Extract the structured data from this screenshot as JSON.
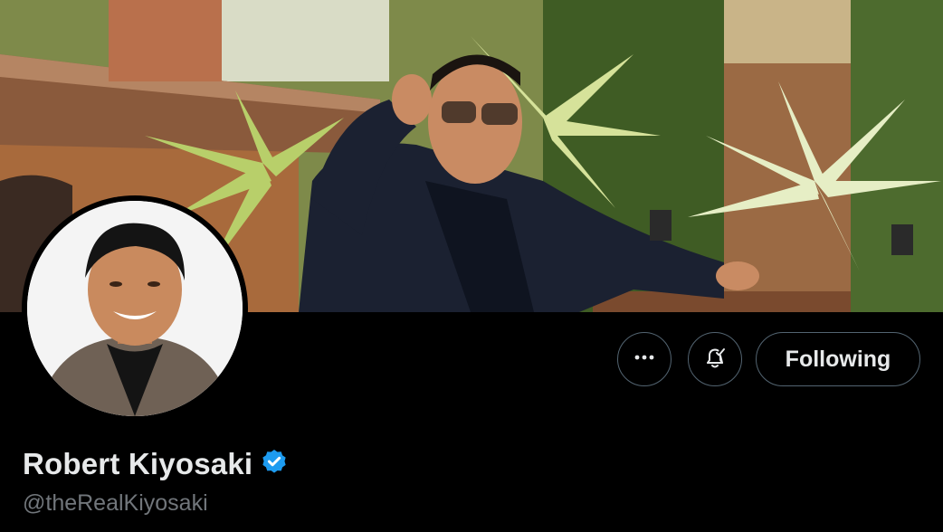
{
  "profile": {
    "display_name": "Robert Kiyosaki",
    "handle": "@theRealKiyosaki",
    "verified": true
  },
  "actions": {
    "more_icon": "more-horizontal-icon",
    "notify_icon": "bell-check-icon",
    "following_label": "Following"
  },
  "colors": {
    "background": "#000000",
    "text_primary": "#e7e9ea",
    "text_secondary": "#71767b",
    "border": "#536471",
    "verified_badge": "#1d9bf0"
  }
}
